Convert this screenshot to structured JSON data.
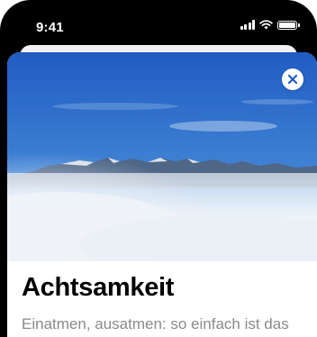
{
  "status_bar": {
    "time": "9:41",
    "icons": [
      "cellular-signal-icon",
      "wifi-icon",
      "battery-icon"
    ]
  },
  "article": {
    "title": "Achtsamkeit",
    "subtitle": "Einatmen, ausatmen: so einfach ist das"
  },
  "actions": {
    "close_icon": "close-icon"
  },
  "colors": {
    "status_text": "#ffffff",
    "title": "#000000",
    "subtitle": "#8a8a8e",
    "sky_top": "#1f5cc2",
    "sky_bottom": "#74aee0",
    "close_button_icon": "#1f5cc2"
  }
}
